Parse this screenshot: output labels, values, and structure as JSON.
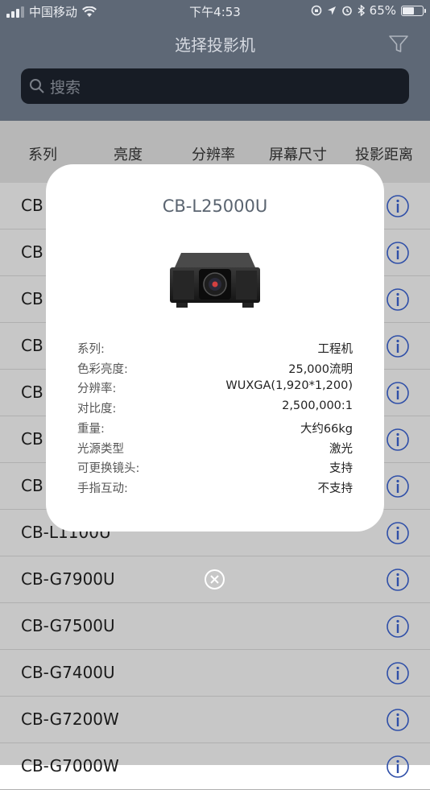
{
  "status_bar": {
    "carrier": "中国移动",
    "time": "下午4:53",
    "battery_percent": "65%",
    "battery_level": 0.65
  },
  "nav": {
    "title": "选择投影机",
    "filter_icon": "filter-icon"
  },
  "search": {
    "placeholder": "搜索",
    "icon": "search-icon"
  },
  "columns": [
    "系列",
    "亮度",
    "分辨率",
    "屏幕尺寸",
    "投影距离"
  ],
  "list": {
    "items": [
      {
        "label": "CB"
      },
      {
        "label": "CB"
      },
      {
        "label": "CB"
      },
      {
        "label": "CB"
      },
      {
        "label": "CB"
      },
      {
        "label": "CB"
      },
      {
        "label": "CB"
      },
      {
        "label": "CB-L1100U"
      },
      {
        "label": "CB-G7900U"
      },
      {
        "label": "CB-G7500U"
      },
      {
        "label": "CB-G7400U"
      },
      {
        "label": "CB-G7200W"
      },
      {
        "label": "CB-G7000W"
      }
    ],
    "info_icon": "info-icon"
  },
  "modal": {
    "title": "CB-L25000U",
    "image_icon": "projector-image",
    "specs": [
      {
        "key": "系列:",
        "value": "工程机"
      },
      {
        "key": "色彩亮度:",
        "value": "25,000流明"
      },
      {
        "key": "分辨率:",
        "value": "WUXGA(1,920*1,200)"
      },
      {
        "key": "对比度:",
        "value": "2,500,000:1"
      },
      {
        "key": "重量:",
        "value": "大约66kg"
      },
      {
        "key": "光源类型",
        "value": "激光"
      },
      {
        "key": "可更换镜头:",
        "value": "支持"
      },
      {
        "key": "手指互动:",
        "value": "不支持"
      }
    ],
    "close_icon": "close-circle-icon"
  },
  "colors": {
    "header_bg": "#5e6876",
    "search_bg": "#171c25",
    "info_blue": "#2f4fa8",
    "overlay_gray": "#c7c7c7"
  }
}
